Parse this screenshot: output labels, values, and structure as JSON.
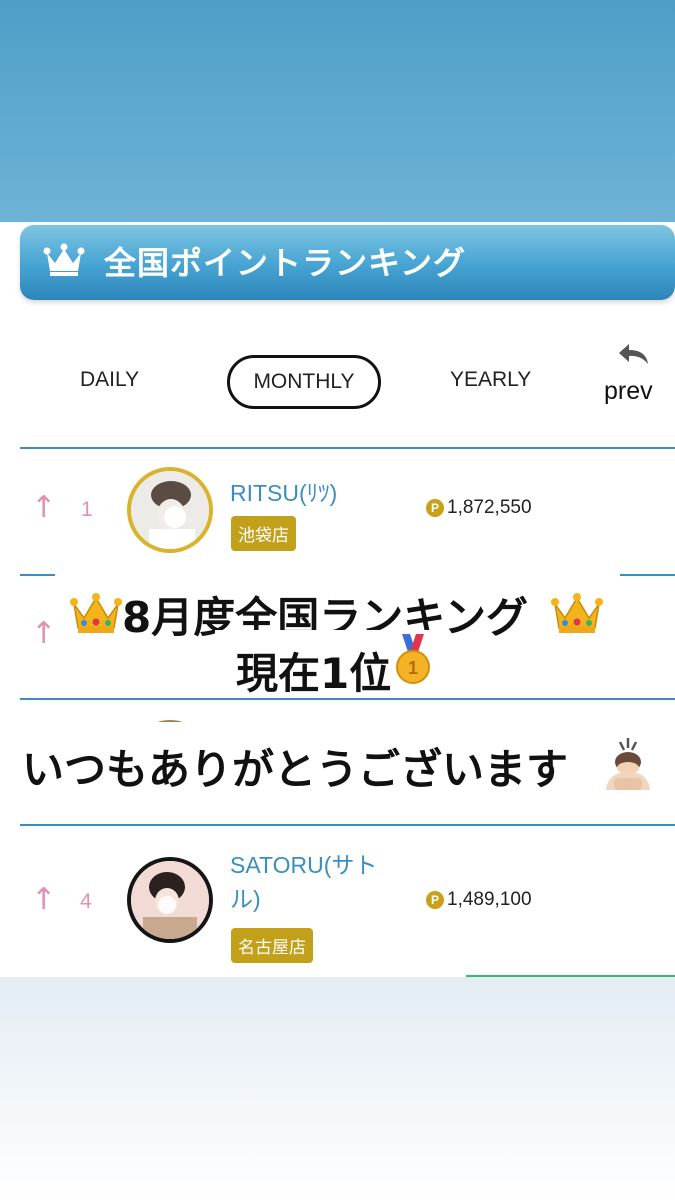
{
  "header": {
    "title": "全国ポイントランキング",
    "icon": "crown-icon"
  },
  "tabs": [
    {
      "label": "DAILY",
      "active": false
    },
    {
      "label": "MONTHLY",
      "active": true
    },
    {
      "label": "YEARLY",
      "active": false
    }
  ],
  "prev": {
    "label": "prev",
    "icon": "back-arrow-icon"
  },
  "rankings": [
    {
      "rank": "1",
      "trend": "↑",
      "name": "RITSU(ﾘﾂ)",
      "store": "池袋店",
      "points": "1,872,550"
    },
    {
      "rank": "",
      "trend": "↑"
    },
    {
      "rank": "4",
      "trend": "↑",
      "name_line1": "SATORU(サト",
      "name_line2": "ル)",
      "store": "名古屋店",
      "points": "1,489,100"
    }
  ],
  "overlay": {
    "line1": "8月度全国ランキング",
    "line2": "現在1位",
    "line3": "いつもありがとうございます"
  },
  "colors": {
    "accent_blue": "#3a8fc0",
    "rank_pink": "#e38fb5",
    "badge_gold": "#c2a019"
  }
}
